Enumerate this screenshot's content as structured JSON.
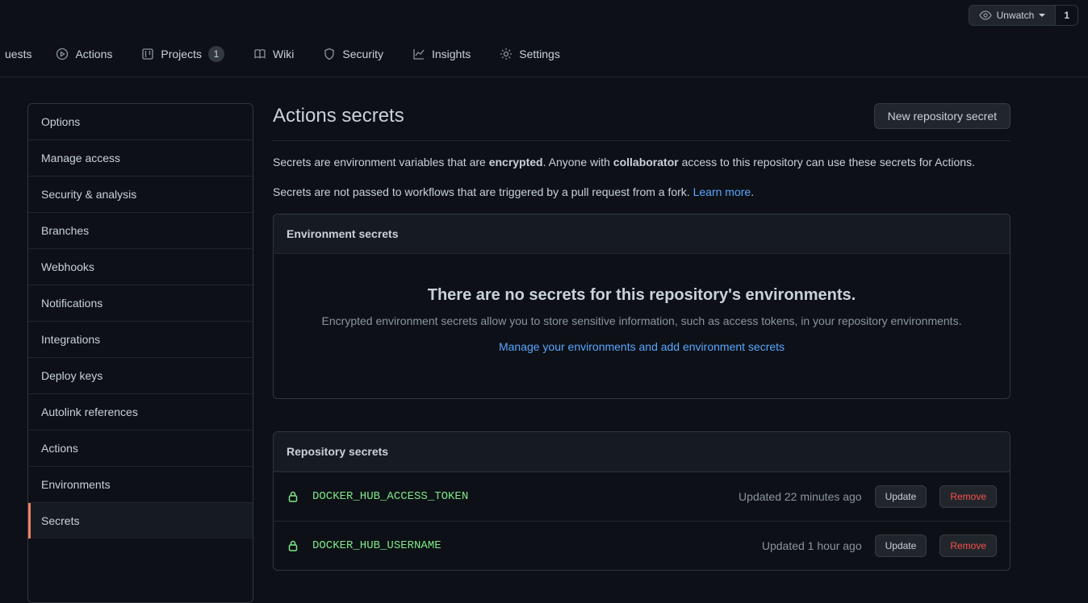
{
  "header": {
    "watch_label": "Unwatch",
    "watch_count": "1"
  },
  "tabs": {
    "partial_leading": "uests",
    "actions": "Actions",
    "projects": "Projects",
    "projects_count": "1",
    "wiki": "Wiki",
    "security": "Security",
    "insights": "Insights",
    "settings": "Settings"
  },
  "sidebar": {
    "items": [
      "Options",
      "Manage access",
      "Security & analysis",
      "Branches",
      "Webhooks",
      "Notifications",
      "Integrations",
      "Deploy keys",
      "Autolink references",
      "Actions",
      "Environments",
      "Secrets"
    ]
  },
  "page": {
    "title": "Actions secrets",
    "new_secret_btn": "New repository secret",
    "desc1_a": "Secrets are environment variables that are ",
    "desc1_b": "encrypted",
    "desc1_c": ". Anyone with ",
    "desc1_d": "collaborator",
    "desc1_e": " access to this repository can use these secrets for Actions.",
    "desc2_a": "Secrets are not passed to workflows that are triggered by a pull request from a fork. ",
    "desc2_link": "Learn more",
    "desc2_b": "."
  },
  "env_box": {
    "title": "Environment secrets",
    "empty_heading": "There are no secrets for this repository's environments.",
    "empty_desc": "Encrypted environment secrets allow you to store sensitive information, such as access tokens, in your repository environments.",
    "empty_link": "Manage your environments and add environment secrets"
  },
  "repo_box": {
    "title": "Repository secrets",
    "update_label": "Update",
    "remove_label": "Remove",
    "secrets": [
      {
        "name": "DOCKER_HUB_ACCESS_TOKEN",
        "updated": "Updated 22 minutes ago"
      },
      {
        "name": "DOCKER_HUB_USERNAME",
        "updated": "Updated 1 hour ago"
      }
    ]
  }
}
